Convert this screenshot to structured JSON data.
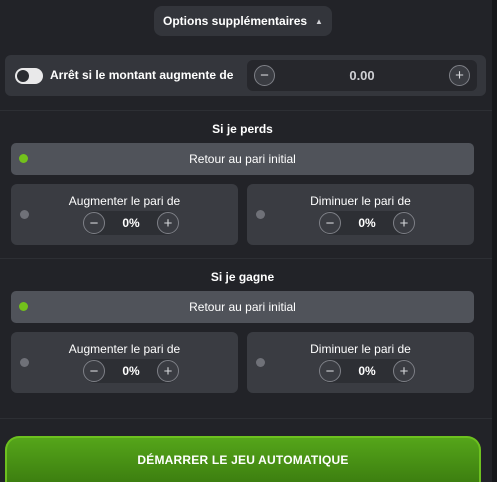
{
  "options": {
    "label": "Options supplémentaires",
    "caret": "▲"
  },
  "stop": {
    "label": "Arrêt si le montant augmente de",
    "value": "0.00",
    "minus": "−",
    "plus": "+"
  },
  "lose": {
    "title": "Si je perds",
    "reset_label": "Retour au pari initial",
    "increase": {
      "title": "Augmenter le pari de",
      "value": "0%"
    },
    "decrease": {
      "title": "Diminuer le pari de",
      "value": "0%"
    }
  },
  "win": {
    "title": "Si je gagne",
    "reset_label": "Retour au pari initial",
    "increase": {
      "title": "Augmenter le pari de",
      "value": "0%"
    },
    "decrease": {
      "title": "Diminuer le pari de",
      "value": "0%"
    }
  },
  "controls": {
    "minus": "−",
    "plus": "+"
  },
  "start": {
    "label": "DÉMARRER LE JEU AUTOMATIQUE"
  },
  "colors": {
    "active_dot": "#73c11c",
    "inactive_dot": "#6f7178",
    "start_green": "#4c9616"
  }
}
